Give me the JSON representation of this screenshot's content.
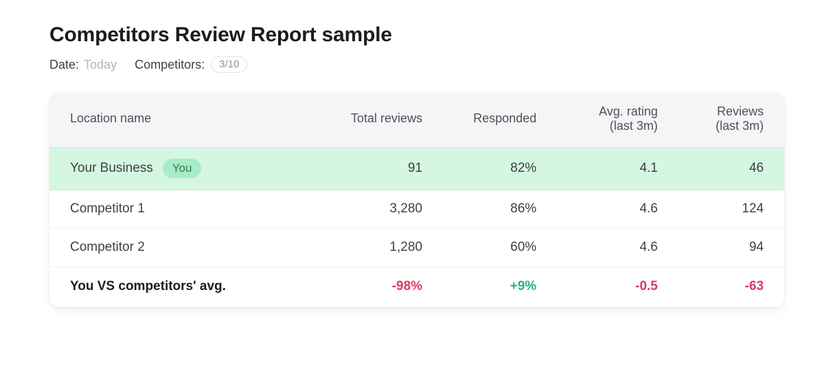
{
  "header": {
    "title": "Competitors Review Report sample",
    "date_label": "Date:",
    "date_value": "Today",
    "competitors_label": "Competitors:",
    "competitors_value": "3/10"
  },
  "table": {
    "columns": {
      "name": "Location name",
      "total_reviews": "Total reviews",
      "responded": "Responded",
      "avg_rating_line1": "Avg. rating",
      "avg_rating_line2": "(last 3m)",
      "reviews_recent_line1": "Reviews",
      "reviews_recent_line2": "(last 3m)"
    },
    "rows": [
      {
        "name": "Your Business",
        "badge": "You",
        "total_reviews": "91",
        "responded": "82%",
        "avg_rating": "4.1",
        "reviews_recent": "46"
      },
      {
        "name": "Competitor 1",
        "total_reviews": "3,280",
        "responded": "86%",
        "avg_rating": "4.6",
        "reviews_recent": "124"
      },
      {
        "name": "Competitor 2",
        "total_reviews": "1,280",
        "responded": "60%",
        "avg_rating": "4.6",
        "reviews_recent": "94"
      }
    ],
    "summary": {
      "name": "You VS competitors' avg.",
      "total_reviews": "-98%",
      "responded": "+9%",
      "avg_rating": "-0.5",
      "reviews_recent": "-63"
    }
  },
  "colors": {
    "negative": "#d93a63",
    "positive": "#23b183",
    "highlight_row": "#d5f6e0",
    "badge_bg": "#a6ecc6",
    "header_bg": "#f4f5f6"
  },
  "chart_data": {
    "type": "table",
    "title": "Competitors Review Report sample",
    "columns": [
      "Location name",
      "Total reviews",
      "Responded",
      "Avg. rating (last 3m)",
      "Reviews (last 3m)"
    ],
    "rows": [
      [
        "Your Business (You)",
        91,
        "82%",
        4.1,
        46
      ],
      [
        "Competitor 1",
        3280,
        "86%",
        4.6,
        124
      ],
      [
        "Competitor 2",
        1280,
        "60%",
        4.6,
        94
      ],
      [
        "You VS competitors' avg.",
        "-98%",
        "+9%",
        -0.5,
        -63
      ]
    ]
  }
}
